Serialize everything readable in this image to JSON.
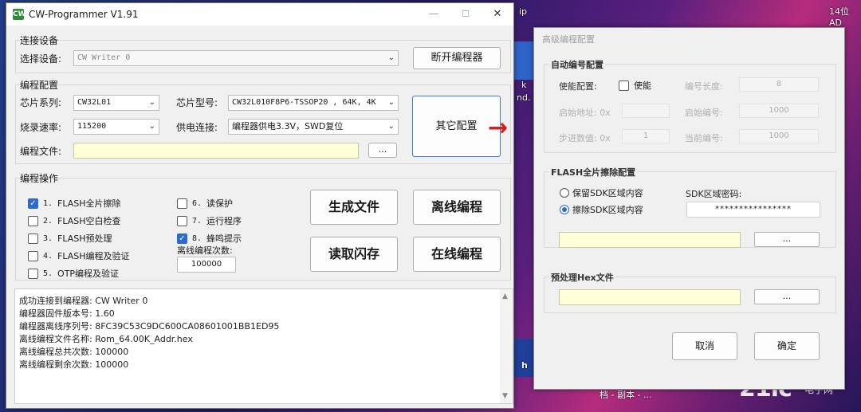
{
  "desktop": {
    "top_right_text": "14位AD",
    "snippet_ip": "ip",
    "snippet_k": "k",
    "snippet_nd": "nd.",
    "snippet_h": "h",
    "taskbar_text": "档 - 副本 - ...",
    "watermark_main": "21ic",
    "watermark_sub": "电子网"
  },
  "main_window": {
    "title": "CW-Programmer V1.91",
    "minimize": "—",
    "maximize": "☐",
    "close": "✕",
    "connect_section": {
      "title": "连接设备",
      "device_label": "选择设备:",
      "device_value": "CW Writer 0",
      "disconnect_button": "断开编程器"
    },
    "config_section": {
      "title": "编程配置",
      "chip_series_label": "芯片系列:",
      "chip_series_value": "CW32L01",
      "chip_model_label": "芯片型号:",
      "chip_model_value": "CW32L010F8P6-TSSOP20 , 64K, 4K",
      "baud_label": "烧录速率:",
      "baud_value": "115200",
      "power_label": "供电连接:",
      "power_value": "编程器供电3.3V，SWD复位",
      "file_label": "编程文件:",
      "file_value": "",
      "browse_button": "...",
      "other_config_button": "其它配置"
    },
    "ops_section": {
      "title": "编程操作",
      "options": [
        {
          "num": "1.",
          "label": "FLASH全片擦除",
          "checked": true
        },
        {
          "num": "2.",
          "label": "FLASH空白检查",
          "checked": false
        },
        {
          "num": "3.",
          "label": "FLASH预处理",
          "checked": false
        },
        {
          "num": "4.",
          "label": "FLASH编程及验证",
          "checked": false
        },
        {
          "num": "5.",
          "label": "OTP编程及验证",
          "checked": false
        },
        {
          "num": "6.",
          "label": "读保护",
          "checked": false
        },
        {
          "num": "7.",
          "label": "运行程序",
          "checked": false
        },
        {
          "num": "8.",
          "label": "蜂鸣提示",
          "checked": true
        }
      ],
      "offline_count_label": "离线编程次数:",
      "offline_count_value": "100000",
      "generate_file_button": "生成文件",
      "offline_program_button": "离线编程",
      "read_flash_button": "读取闪存",
      "online_program_button": "在线编程"
    },
    "log_lines": [
      "成功连接到编程器: CW Writer 0",
      "编程器固件版本号: 1.60",
      "编程器离线序列号: 8FC39C53C9DC600CA08601001BB1ED95",
      "离线编程文件名称: Rom_64.00K_Addr.hex",
      "离线编程总共次数: 100000",
      "离线编程剩余次数: 100000"
    ],
    "scroll_up": "▲",
    "scroll_down": "▼"
  },
  "arrow": "→",
  "advanced_window": {
    "title": "高级编程配置",
    "auto_number": {
      "title": "自动编号配置",
      "enable_label": "使能配置:",
      "enable_checkbox": "使能",
      "length_label": "编号长度:",
      "length_value": "8",
      "start_addr_label": "启始地址: 0x",
      "start_addr_value": "",
      "start_number_label": "启始编号:",
      "start_number_value": "1000",
      "step_label": "步进数值: 0x",
      "step_value": "1",
      "current_number_label": "当前编号:",
      "current_number_value": "1000"
    },
    "flash_erase": {
      "title": "FLASH全片擦除配置",
      "keep_sdk": "保留SDK区域内容",
      "erase_sdk": "擦除SDK区域内容",
      "sdk_password_label": "SDK区域密码:",
      "sdk_password_value": "****************",
      "browse_button": "..."
    },
    "preprocess": {
      "title": "预处理Hex文件",
      "browse_button": "..."
    },
    "cancel_button": "取消",
    "ok_button": "确定"
  }
}
